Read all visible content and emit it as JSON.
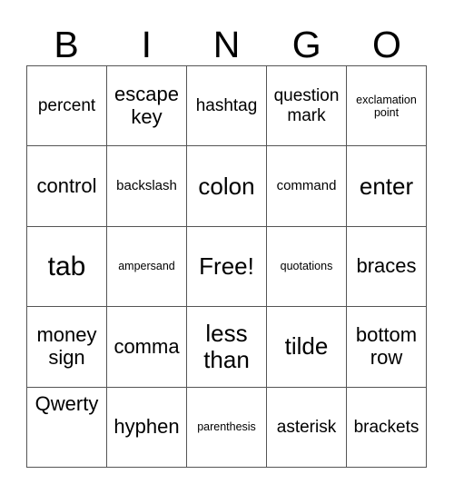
{
  "card": {
    "header_letters": [
      "B",
      "I",
      "N",
      "G",
      "O"
    ],
    "grid": {
      "rows": 5,
      "columns": 5,
      "border_color": "#555555",
      "background_color": "#ffffff",
      "text_color": "#000000"
    },
    "cells": [
      {
        "text": "percent",
        "size": "m",
        "align": "middle"
      },
      {
        "text": "escape\nkey",
        "size": "l",
        "align": "middle"
      },
      {
        "text": "hashtag",
        "size": "m",
        "align": "middle"
      },
      {
        "text": "question\nmark",
        "size": "m",
        "align": "middle"
      },
      {
        "text": "exclamation\npoint",
        "size": "xs",
        "align": "middle"
      },
      {
        "text": "control",
        "size": "l",
        "align": "middle"
      },
      {
        "text": "backslash",
        "size": "s",
        "align": "middle"
      },
      {
        "text": "colon",
        "size": "xl",
        "align": "middle"
      },
      {
        "text": "command",
        "size": "s",
        "align": "middle"
      },
      {
        "text": "enter",
        "size": "xl",
        "align": "middle"
      },
      {
        "text": "tab",
        "size": "xxl",
        "align": "middle"
      },
      {
        "text": "ampersand",
        "size": "xs",
        "align": "middle"
      },
      {
        "text": "Free!",
        "size": "xl",
        "align": "middle"
      },
      {
        "text": "quotations",
        "size": "xs",
        "align": "middle"
      },
      {
        "text": "braces",
        "size": "l",
        "align": "middle"
      },
      {
        "text": "money\nsign",
        "size": "l",
        "align": "middle"
      },
      {
        "text": "comma",
        "size": "l",
        "align": "middle"
      },
      {
        "text": "less\nthan",
        "size": "xl",
        "align": "middle"
      },
      {
        "text": "tilde",
        "size": "xl",
        "align": "middle"
      },
      {
        "text": "bottom\nrow",
        "size": "l",
        "align": "middle"
      },
      {
        "text": "Qwerty",
        "size": "l",
        "align": "top"
      },
      {
        "text": "hyphen",
        "size": "l",
        "align": "middle"
      },
      {
        "text": "parenthesis",
        "size": "xs",
        "align": "middle"
      },
      {
        "text": "asterisk",
        "size": "m",
        "align": "middle"
      },
      {
        "text": "brackets",
        "size": "m",
        "align": "middle"
      }
    ]
  }
}
